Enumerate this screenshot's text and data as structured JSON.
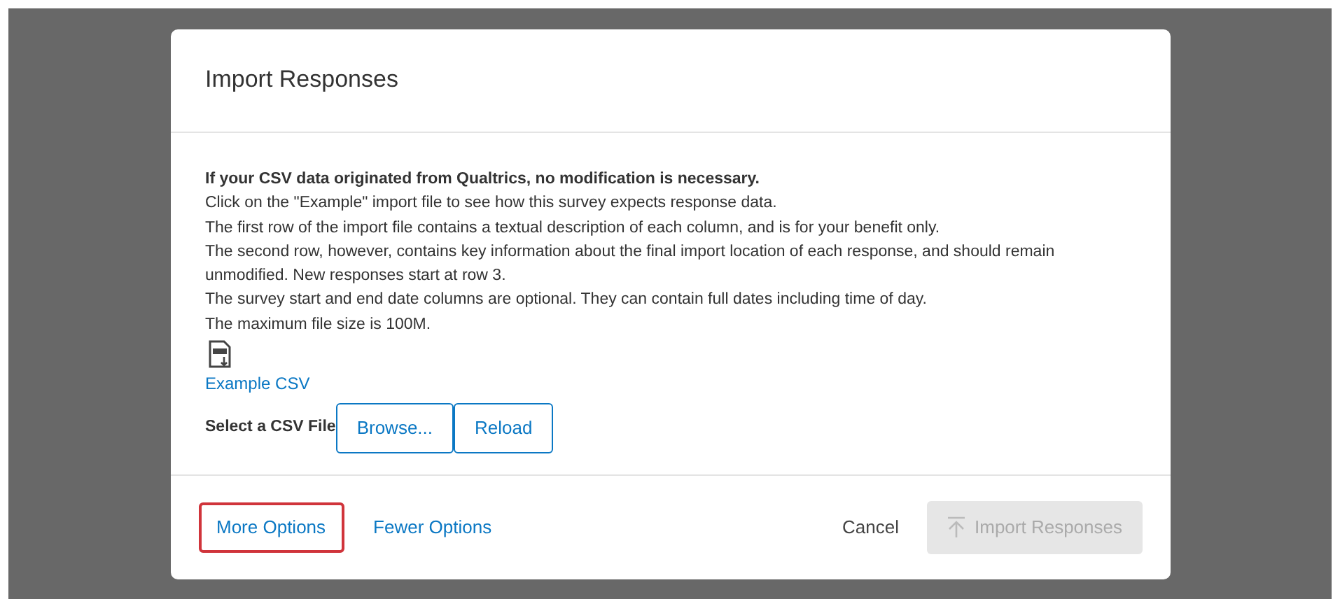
{
  "dialog": {
    "title": "Import Responses",
    "intro_bold": "If your CSV data originated from Qualtrics, no modification is necessary.",
    "lines": [
      "Click on the \"Example\" import file to see how this survey expects response data.",
      "The first row of the import file contains a textual description of each column, and is for your benefit only.",
      "The second row, however, contains key information about the final import location of each response, and should remain unmodified. New responses start at row 3.",
      "The survey start and end date columns are optional. They can contain full dates including time of day.",
      "The maximum file size is 100M."
    ],
    "example_link": "Example CSV",
    "file_label": "Select a CSV File",
    "file_buttons": [
      "Browse...",
      "Reload"
    ],
    "footer_links": [
      {
        "label": "More Options",
        "highlighted": true
      },
      {
        "label": "Fewer Options",
        "highlighted": false
      }
    ],
    "cancel": "Cancel",
    "import_button": {
      "label": "Import Responses",
      "disabled": true
    }
  }
}
